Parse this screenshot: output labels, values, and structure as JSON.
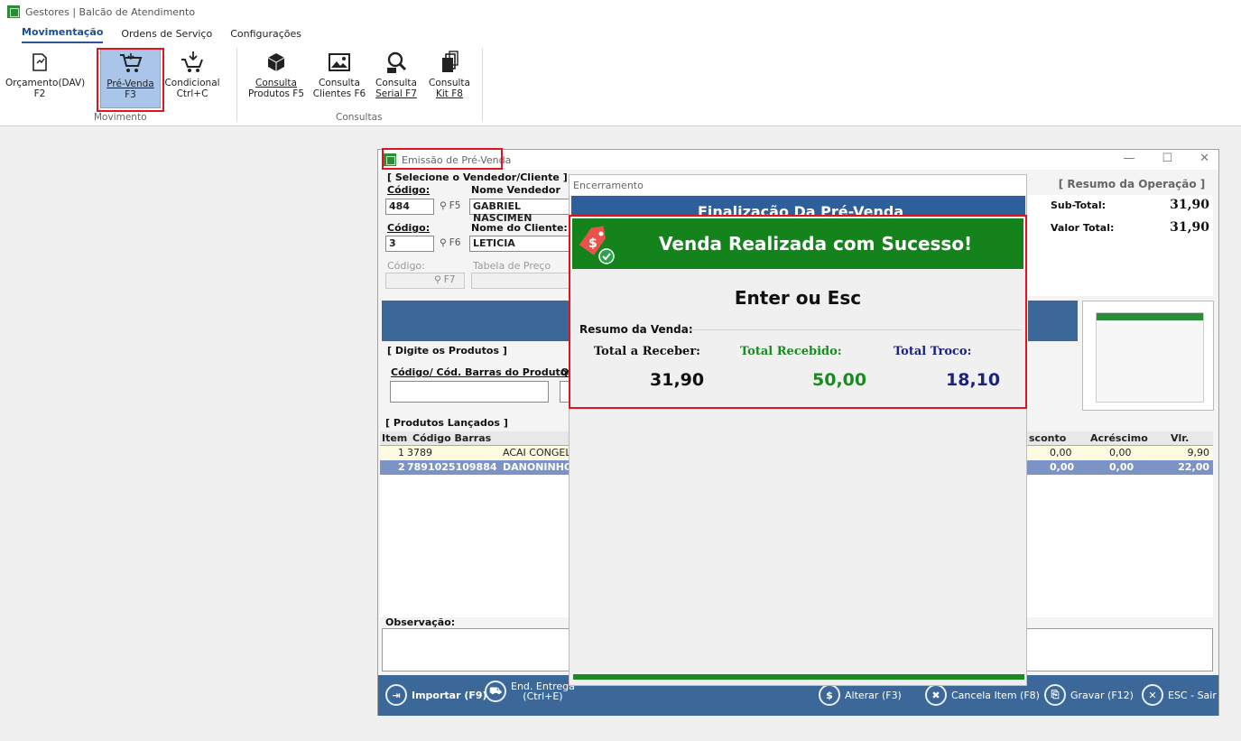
{
  "app": {
    "title": "Gestores | Balcão de Atendimento",
    "tabs": [
      "Movimentação",
      "Ordens de Serviço",
      "Configurações"
    ]
  },
  "ribbon": {
    "buttons": [
      {
        "line1": "Orçamento(DAV)",
        "line2": "F2",
        "icon": "quote-icon"
      },
      {
        "line1": "Pré-Venda",
        "line2": "F3",
        "icon": "cart-icon"
      },
      {
        "line1": "Condicional",
        "line2": "Ctrl+C",
        "icon": "cart-down-icon"
      },
      {
        "line1": "Consulta",
        "line2": "Produtos F5",
        "icon": "box-icon"
      },
      {
        "line1": "Consulta",
        "line2": "Clientes F6",
        "icon": "image-icon"
      },
      {
        "line1": "Consulta",
        "line2": "Serial F7",
        "icon": "magnifier-icon"
      },
      {
        "line1": "Consulta",
        "line2": "Kit F8",
        "icon": "stack-icon"
      }
    ],
    "groups": [
      "Movimento",
      "Consultas"
    ]
  },
  "window": {
    "title": "Emissão de Pré-Venda",
    "section_seller_client": "[ Selecione o Vendedor/Cliente ]",
    "codigo_label": "Código:",
    "seller_code": "484",
    "seller_fkey": "F5",
    "seller_name_label": "Nome Vendedor",
    "seller_name": "GABRIEL NASCIMEN",
    "client_code": "3",
    "client_fkey": "F6",
    "client_name_label": "Nome do Cliente:",
    "client_name": "LETICIA",
    "price_code_fkey": "F7",
    "price_table_label": "Tabela de Preço",
    "section_products": "[ Digite os Produtos ]",
    "barcode_label": "Código/ Cód. Barras do Produto:",
    "qty_label_partial": "Q",
    "section_launched": "[ Produtos Lançados ]",
    "summary_title": "[ Resumo da Operação ]",
    "subtotal_label": "Sub-Total:",
    "subtotal_value": "31,90",
    "total_label": "Valor Total:",
    "total_value": "31,90",
    "observation_label": "Observação:",
    "grid": {
      "headers": [
        "Item",
        "Código Barras",
        "sconto",
        "Acréscimo",
        "Vlr. Total"
      ],
      "rows": [
        {
          "item": "1",
          "barcode": "3789",
          "desc": "ACAI CONGELAI",
          "desconto": "0,00",
          "acrescimo": "0,00",
          "total": "9,90"
        },
        {
          "item": "2",
          "barcode": "7891025109884",
          "desc": "DANONINHO L",
          "desconto": "0,00",
          "acrescimo": "0,00",
          "total": "22,00"
        }
      ]
    },
    "bottom_buttons": {
      "importar": "Importar (F9)",
      "end_entrega_1": "End. Entrega",
      "end_entrega_2": "(Ctrl+E)",
      "alterar": "Alterar (F3)",
      "cancela": "Cancela Item (F8)",
      "gravar": "Gravar (F12)",
      "sair": "ESC - Sair"
    }
  },
  "dialog": {
    "title": "Encerramento",
    "header_partial": "Finalização Da Pré-Venda"
  },
  "success": {
    "heading": "Venda Realizada com Sucesso!",
    "hint": "Enter ou Esc",
    "resumo_label": "Resumo da Venda:",
    "total_receber_label": "Total a Receber:",
    "total_receber": "31,90",
    "total_recebido_label": "Total Recebido:",
    "total_recebido": "50,00",
    "total_troco_label": "Total Troco:",
    "total_troco": "18,10",
    "colors": {
      "receber": "#111111",
      "recebido": "#1b8a22",
      "troco": "#1a237e",
      "header": "#15831c"
    }
  }
}
